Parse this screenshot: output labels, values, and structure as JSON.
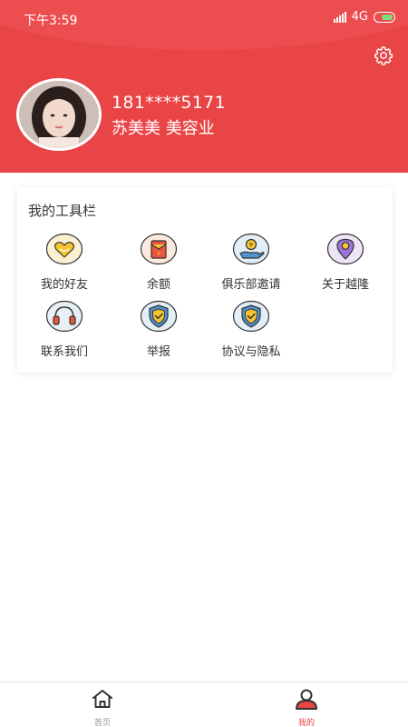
{
  "status_bar": {
    "time": "下午3:59",
    "network": "4G",
    "battery_color": "#7be07b"
  },
  "header": {
    "background_color": "#e94446",
    "settings_icon": "gear-icon"
  },
  "profile": {
    "phone": "181****5171",
    "name_line": "苏美美 美容业"
  },
  "toolbar": {
    "title": "我的工具栏",
    "items": [
      {
        "label": "我的好友",
        "icon": "heart-icon"
      },
      {
        "label": "余额",
        "icon": "wallet-icon"
      },
      {
        "label": "俱乐部邀请",
        "icon": "invite-hand-icon"
      },
      {
        "label": "关于越隆",
        "icon": "location-pin-icon"
      },
      {
        "label": "联系我们",
        "icon": "headset-icon"
      },
      {
        "label": "举报",
        "icon": "shield-check-icon"
      },
      {
        "label": "协议与隐私",
        "icon": "shield-check-icon"
      }
    ]
  },
  "bottom_nav": {
    "items": [
      {
        "label": "首页",
        "icon": "home-icon",
        "active": false
      },
      {
        "label": "我的",
        "icon": "user-icon",
        "active": true
      }
    ],
    "active_color": "#e94446",
    "inactive_color": "#999999"
  }
}
